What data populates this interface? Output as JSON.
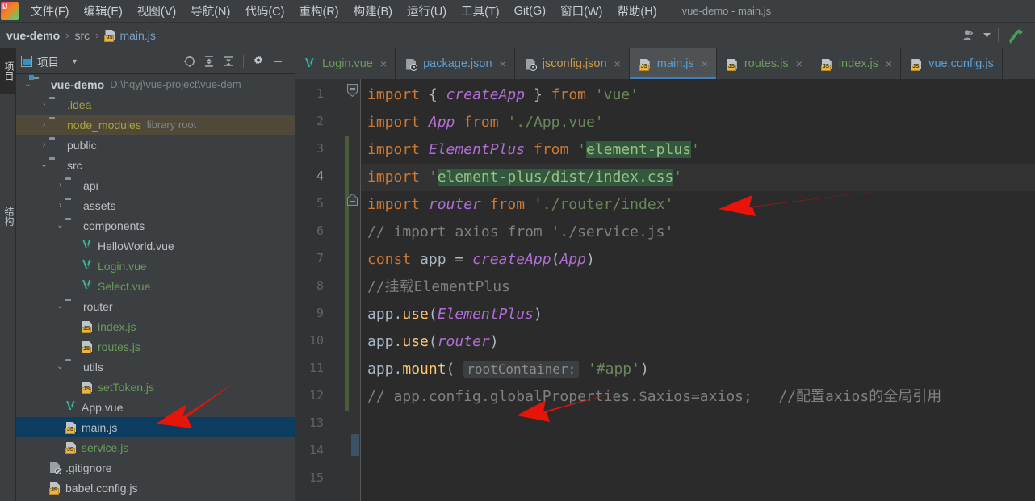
{
  "menu": {
    "items": [
      {
        "label": "文件(F)",
        "mnemonic": "F"
      },
      {
        "label": "编辑(E)",
        "mnemonic": "E"
      },
      {
        "label": "视图(V)",
        "mnemonic": "V"
      },
      {
        "label": "导航(N)",
        "mnemonic": "N"
      },
      {
        "label": "代码(C)",
        "mnemonic": "C"
      },
      {
        "label": "重构(R)",
        "mnemonic": "R"
      },
      {
        "label": "构建(B)",
        "mnemonic": "B"
      },
      {
        "label": "运行(U)",
        "mnemonic": "U"
      },
      {
        "label": "工具(T)",
        "mnemonic": "T"
      },
      {
        "label": "Git(G)",
        "mnemonic": "G"
      },
      {
        "label": "窗口(W)",
        "mnemonic": "W"
      },
      {
        "label": "帮助(H)",
        "mnemonic": "H"
      }
    ],
    "window_title": "vue-demo - main.js"
  },
  "navbar": {
    "crumbs": [
      "vue-demo",
      "src",
      "main.js"
    ],
    "separator": "›",
    "icons": [
      "user-account-icon",
      "chevron-down-icon",
      "hammer-build-icon"
    ]
  },
  "left_strip": {
    "tabs": [
      {
        "label": "项目",
        "active": true
      },
      {
        "label": "结构",
        "active": false
      }
    ]
  },
  "project_panel": {
    "title": "项目",
    "title_caret": "▼",
    "actions": [
      "locate-target-icon",
      "expand-all-icon",
      "collapse-all-icon",
      "settings-gear-icon",
      "hide-minimize-icon"
    ],
    "tree": [
      {
        "indent": 0,
        "arrow": "⌄",
        "icon": "folder-module-icon",
        "label": "vue-demo",
        "style": "bold",
        "sub": "D:\\hqyj\\vue-project\\vue-dem",
        "state": "normal"
      },
      {
        "indent": 1,
        "arrow": "›",
        "icon": "folder-icon",
        "label": ".idea",
        "style": "yellow",
        "sub": "",
        "state": "normal"
      },
      {
        "indent": 1,
        "arrow": "›",
        "icon": "folder-icon",
        "label": "node_modules",
        "style": "yellow",
        "sub": "library root",
        "state": "highlight"
      },
      {
        "indent": 1,
        "arrow": "›",
        "icon": "folder-icon",
        "label": "public",
        "style": "white",
        "sub": "",
        "state": "normal"
      },
      {
        "indent": 1,
        "arrow": "⌄",
        "icon": "folder-icon",
        "label": "src",
        "style": "white",
        "sub": "",
        "state": "normal"
      },
      {
        "indent": 2,
        "arrow": "›",
        "icon": "folder-icon",
        "label": "api",
        "style": "white",
        "sub": "",
        "state": "normal"
      },
      {
        "indent": 2,
        "arrow": "›",
        "icon": "folder-icon",
        "label": "assets",
        "style": "white",
        "sub": "",
        "state": "normal"
      },
      {
        "indent": 2,
        "arrow": "⌄",
        "icon": "folder-icon",
        "label": "components",
        "style": "white",
        "sub": "",
        "state": "normal"
      },
      {
        "indent": 3,
        "arrow": "",
        "icon": "vue-file-icon",
        "label": "HelloWorld.vue",
        "style": "white",
        "sub": "",
        "state": "normal"
      },
      {
        "indent": 3,
        "arrow": "",
        "icon": "vue-file-icon",
        "label": "Login.vue",
        "style": "green",
        "sub": "",
        "state": "normal"
      },
      {
        "indent": 3,
        "arrow": "",
        "icon": "vue-file-icon",
        "label": "Select.vue",
        "style": "green",
        "sub": "",
        "state": "normal"
      },
      {
        "indent": 2,
        "arrow": "⌄",
        "icon": "folder-icon",
        "label": "router",
        "style": "white",
        "sub": "",
        "state": "normal"
      },
      {
        "indent": 3,
        "arrow": "",
        "icon": "js-file-icon",
        "label": "index.js",
        "style": "green",
        "sub": "",
        "state": "normal"
      },
      {
        "indent": 3,
        "arrow": "",
        "icon": "js-file-icon",
        "label": "routes.js",
        "style": "green",
        "sub": "",
        "state": "normal"
      },
      {
        "indent": 2,
        "arrow": "⌄",
        "icon": "folder-icon",
        "label": "utils",
        "style": "white",
        "sub": "",
        "state": "normal"
      },
      {
        "indent": 3,
        "arrow": "",
        "icon": "js-file-icon",
        "label": "setToken.js",
        "style": "green",
        "sub": "",
        "state": "normal"
      },
      {
        "indent": 2,
        "arrow": "",
        "icon": "vue-file-icon",
        "label": "App.vue",
        "style": "white",
        "sub": "",
        "state": "normal"
      },
      {
        "indent": 2,
        "arrow": "",
        "icon": "js-file-icon",
        "label": "main.js",
        "style": "white",
        "sub": "",
        "state": "selected"
      },
      {
        "indent": 2,
        "arrow": "",
        "icon": "js-file-icon",
        "label": "service.js",
        "style": "green",
        "sub": "",
        "state": "normal"
      },
      {
        "indent": 1,
        "arrow": "",
        "icon": "gitignore-file-icon",
        "label": ".gitignore",
        "style": "white",
        "sub": "",
        "state": "normal"
      },
      {
        "indent": 1,
        "arrow": "",
        "icon": "js-file-icon",
        "label": "babel.config.js",
        "style": "white",
        "sub": "",
        "state": "normal"
      }
    ]
  },
  "editor": {
    "tabs": [
      {
        "label": "Login.vue",
        "icon": "vue-file-icon",
        "color": "green",
        "active": false,
        "close": "×"
      },
      {
        "label": "package.json",
        "icon": "json-file-icon",
        "color": "blue",
        "active": false,
        "close": "×"
      },
      {
        "label": "jsconfig.json",
        "icon": "json-file-icon",
        "color": "orange",
        "active": false,
        "close": "×"
      },
      {
        "label": "main.js",
        "icon": "js-file-icon",
        "color": "blue",
        "active": true,
        "close": "×"
      },
      {
        "label": "routes.js",
        "icon": "js-file-icon",
        "color": "green",
        "active": false,
        "close": "×"
      },
      {
        "label": "index.js",
        "icon": "js-file-icon",
        "color": "green",
        "active": false,
        "close": "×"
      },
      {
        "label": "vue.config.js",
        "icon": "js-file-icon",
        "color": "blue",
        "active": false,
        "close": ""
      }
    ],
    "current_line": 4,
    "line_numbers": [
      1,
      2,
      3,
      4,
      5,
      6,
      7,
      8,
      9,
      10,
      11,
      12,
      13,
      14,
      15
    ],
    "code_lines": [
      "import { createApp } from 'vue'",
      "import App from './App.vue'",
      "import ElementPlus from 'element-plus'",
      "import 'element-plus/dist/index.css'",
      "import router from './router/index'",
      "// import axios from './service.js'",
      "const app = createApp(App)",
      "//挂载ElementPlus",
      "app.use(ElementPlus)",
      "app.use(router)",
      "app.mount( rootContainer: '#app')",
      "// app.config.globalProperties.$axios=axios;   //配置axios的全局引用",
      "",
      "",
      ""
    ],
    "inlay_hint": "rootContainer:",
    "fold_lines": [
      1,
      5
    ],
    "change_bar_from_line": 3,
    "change_bar_to_line": 12
  },
  "annotations": {
    "arrows": [
      {
        "name": "arrow-to-import-router",
        "points_at": "line 5 import router from './router/index'"
      },
      {
        "name": "arrow-to-app-use-router",
        "points_at": "line 10 app.use(router)"
      },
      {
        "name": "arrow-to-main-js-tree-item",
        "points_at": "main.js in project tree"
      }
    ],
    "color": "#E81309"
  },
  "colors": {
    "background": "#3C3F41",
    "editor_background": "#2B2B2B",
    "gutter_background": "#313335",
    "selection": "#0D3C61",
    "highlight_row": "#50493A",
    "accent_tab": "#3D7FC1",
    "keyword": "#CC7832",
    "string": "#6A8759",
    "comment": "#808080",
    "class_name": "#B16ED6",
    "function": "#FFC66D",
    "search_highlight": "#32593D",
    "change_bar": "#4B5C3B"
  }
}
